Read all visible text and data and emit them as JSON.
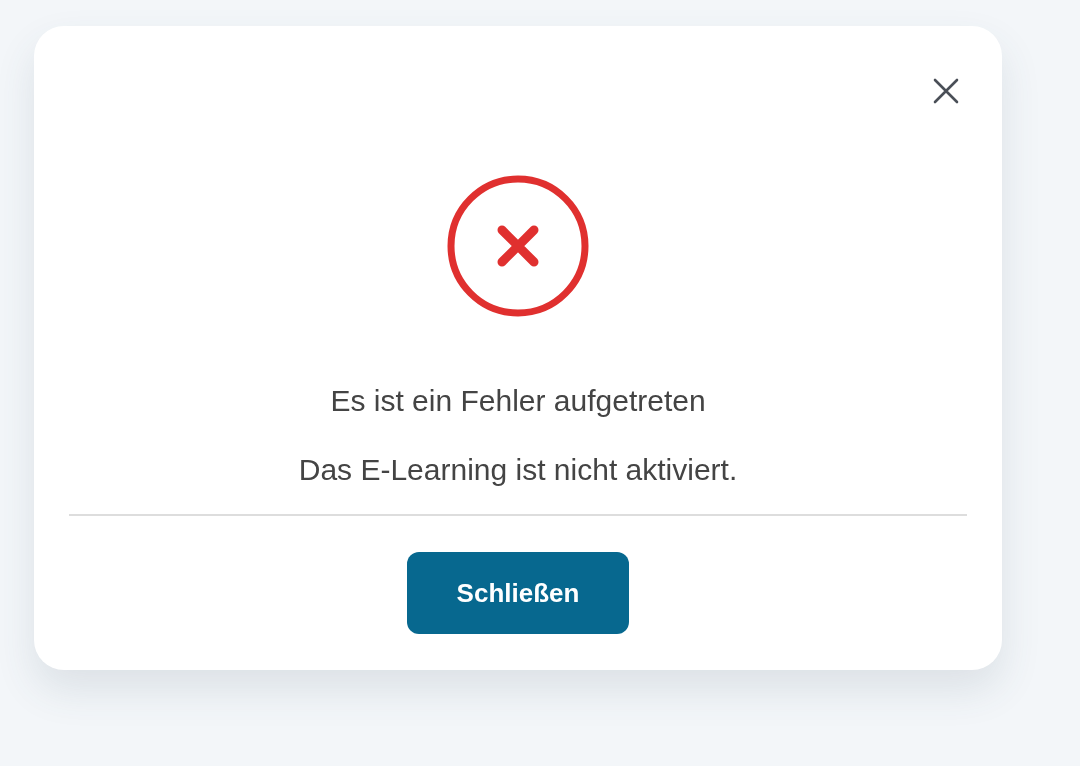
{
  "dialog": {
    "kind": "error",
    "title": "Es ist ein Fehler aufgetreten",
    "message": "Das E-Learning ist nicht aktiviert.",
    "buttons": [
      "Schließen"
    ]
  }
}
